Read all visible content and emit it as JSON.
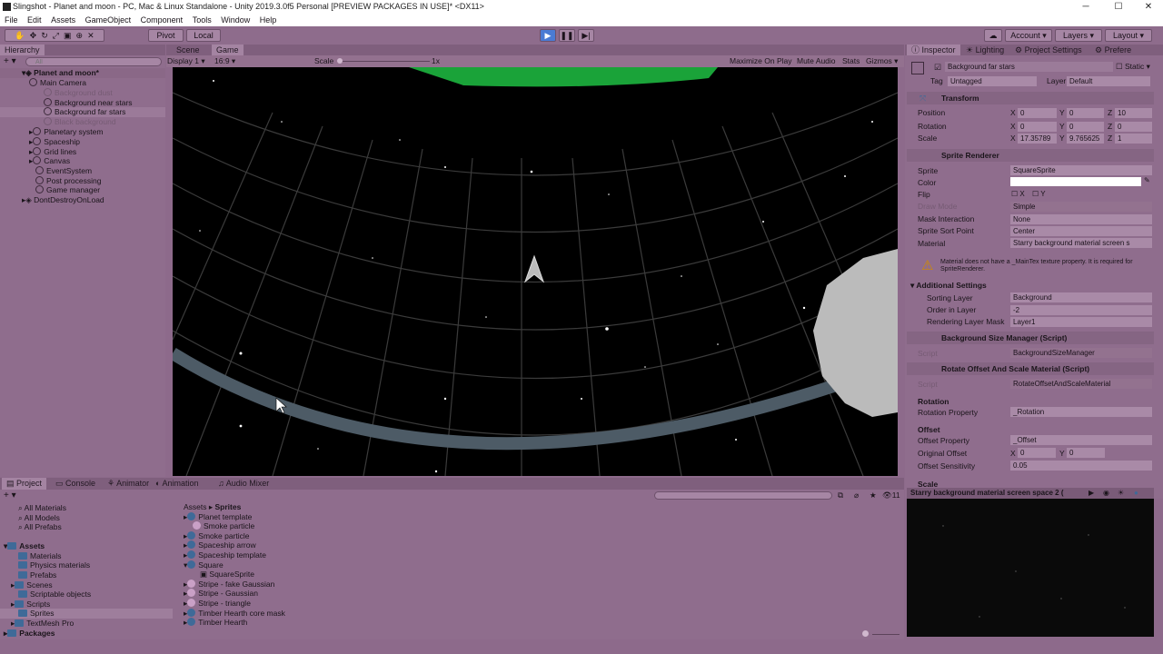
{
  "window": {
    "title": "Slingshot - Planet and moon - PC, Mac & Linux Standalone - Unity 2019.3.0f5 Personal [PREVIEW PACKAGES IN USE]* <DX11>",
    "minimize": "─",
    "maximize": "☐",
    "close": "✕"
  },
  "menu": [
    "File",
    "Edit",
    "Assets",
    "GameObject",
    "Component",
    "Tools",
    "Window",
    "Help"
  ],
  "toolbar": {
    "pivot": "Pivot",
    "local": "Local",
    "account": "Account",
    "layers": "Layers",
    "layout": "Layout"
  },
  "hierarchy": {
    "tab": "Hierarchy",
    "search_placeholder": "All",
    "scene": "Planet and moon*",
    "items": [
      "Main Camera",
      "Background dust",
      "Background near stars",
      "Background far stars",
      "Black background",
      "Planetary system",
      "Spaceship",
      "Grid lines",
      "Canvas",
      "EventSystem",
      "Post processing",
      "Game manager",
      "DontDestroyOnLoad"
    ]
  },
  "scene_tabs": {
    "scene": "Scene",
    "game": "Game"
  },
  "game_bar": {
    "display": "Display 1",
    "aspect": "16:9",
    "scale_label": "Scale",
    "scale_value": "1x",
    "maximize": "Maximize On Play",
    "mute": "Mute Audio",
    "stats": "Stats",
    "gizmos": "Gizmos"
  },
  "inspector": {
    "tabs": [
      "Inspector",
      "Lighting",
      "Project Settings",
      "Prefere"
    ],
    "object_name": "Background far stars",
    "static_label": "Static",
    "tag_label": "Tag",
    "tag_value": "Untagged",
    "layer_label": "Layer",
    "layer_value": "Default",
    "transform": {
      "title": "Transform",
      "position": [
        "0",
        "0",
        "10"
      ],
      "rotation": [
        "0",
        "0",
        "0"
      ],
      "scale": [
        "17.35789",
        "9.765625",
        "1"
      ],
      "labels": [
        "Position",
        "Rotation",
        "Scale"
      ]
    },
    "axes": [
      "X",
      "Y",
      "Z"
    ],
    "sprite_renderer": {
      "title": "Sprite Renderer",
      "sprite_label": "Sprite",
      "sprite": "SquareSprite",
      "color_label": "Color",
      "flip_label": "Flip",
      "flip_x": "X",
      "flip_y": "Y",
      "draw_mode_label": "Draw Mode",
      "draw_mode": "Simple",
      "mask_label": "Mask Interaction",
      "mask": "None",
      "sort_point_label": "Sprite Sort Point",
      "sort_point": "Center",
      "material_label": "Material",
      "material": "Starry background material screen s",
      "warning": "Material does not have a _MainTex texture property. It is required for SpriteRenderer."
    },
    "additional": {
      "title": "Additional Settings",
      "sorting_layer_label": "Sorting Layer",
      "sorting_layer": "Background",
      "order_label": "Order in Layer",
      "order": "-2",
      "rendering_mask_label": "Rendering Layer Mask",
      "rendering_mask": "Layer1"
    },
    "bg_size": {
      "title": "Background Size Manager (Script)",
      "script_label": "Script",
      "script": "BackgroundSizeManager"
    },
    "rotate_offset": {
      "title": "Rotate Offset And Scale Material (Script)",
      "script_label": "Script",
      "script": "RotateOffsetAndScaleMaterial",
      "rotation_header": "Rotation",
      "rotation_property_label": "Rotation Property",
      "rotation_property": "_Rotation",
      "offset_header": "Offset",
      "offset_property_label": "Offset Property",
      "offset_property": "_Offset",
      "original_offset_label": "Original Offset",
      "original_offset": [
        "0",
        "0"
      ],
      "sensitivity_label": "Offset Sensitivity",
      "sensitivity": "0.05",
      "scale_header": "Scale"
    },
    "preview_title": "Starry background material screen space 2 ("
  },
  "bottom_tabs": [
    "Project",
    "Console",
    "Animator",
    "Animation",
    "Audio Mixer"
  ],
  "project": {
    "favorites": [
      "All Materials",
      "All Models",
      "All Prefabs"
    ],
    "assets_label": "Assets",
    "folders": [
      "Materials",
      "Physics materials",
      "Prefabs",
      "Scenes",
      "Scriptable objects",
      "Scripts",
      "Sprites",
      "TextMesh Pro"
    ],
    "packages": "Packages",
    "breadcrumb": [
      "Assets",
      "Sprites"
    ],
    "files": [
      "Planet template",
      "Smoke particle",
      "Smoke particle",
      "Spaceship arrow",
      "Spaceship template",
      "Square",
      "SquareSprite",
      "Stripe - fake Gaussian",
      "Stripe - Gaussian",
      "Stripe - triangle",
      "Timber Hearth core mask",
      "Timber Hearth"
    ],
    "count": "11"
  },
  "colors": {
    "accent": "#4a7bd4",
    "tint": "#8d6a8b"
  }
}
